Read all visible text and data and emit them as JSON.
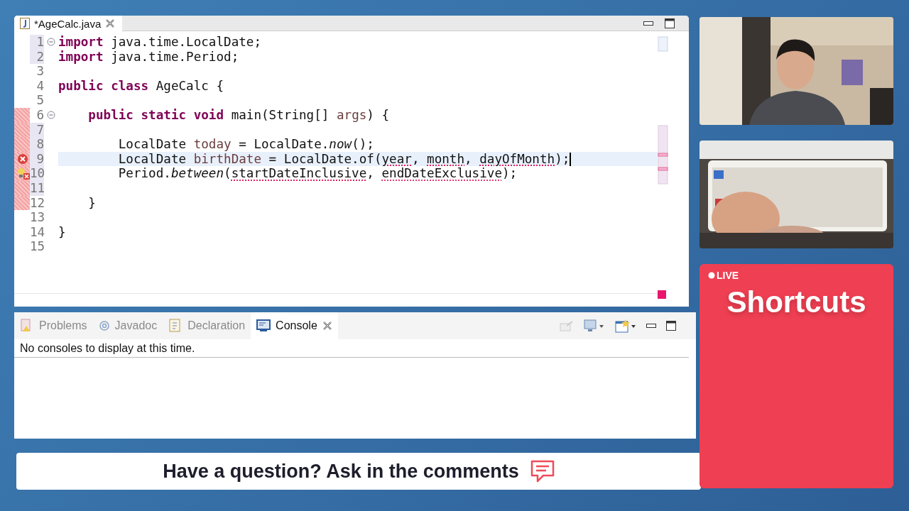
{
  "editor": {
    "tab": {
      "label": "*AgeCalc.java",
      "selected": true
    },
    "lines": [
      {
        "number": "1",
        "fold": true,
        "changed": true,
        "tokens": [
          {
            "kind": "keyword",
            "text": "import"
          },
          {
            "kind": "text",
            "text": " java.time.LocalDate;"
          }
        ]
      },
      {
        "number": "2",
        "changed": true,
        "tokens": [
          {
            "kind": "keyword",
            "text": "import"
          },
          {
            "kind": "text",
            "text": " java.time.Period;"
          }
        ]
      },
      {
        "number": "3"
      },
      {
        "number": "4",
        "tokens": [
          {
            "kind": "keyword",
            "text": "public"
          },
          {
            "kind": "keyword",
            "text": " class"
          },
          {
            "kind": "text",
            "text": " AgeCalc {"
          }
        ]
      },
      {
        "number": "5"
      },
      {
        "number": "6",
        "fold": true,
        "error_range": true,
        "tokens": [
          {
            "kind": "keyword",
            "text": "    public"
          },
          {
            "kind": "keyword",
            "text": " static"
          },
          {
            "kind": "keyword",
            "text": " void"
          },
          {
            "kind": "text",
            "text": " main(String[] "
          },
          {
            "kind": "field",
            "text": "args"
          },
          {
            "kind": "text",
            "text": ") {"
          }
        ]
      },
      {
        "number": "7",
        "changed": true,
        "error_range": true
      },
      {
        "number": "8",
        "changed": true,
        "error_range": true,
        "tokens": [
          {
            "kind": "text",
            "text": "        LocalDate "
          },
          {
            "kind": "field",
            "text": "today"
          },
          {
            "kind": "text",
            "text": " = LocalDate."
          },
          {
            "kind": "static",
            "text": "now"
          },
          {
            "kind": "text",
            "text": "();"
          }
        ]
      },
      {
        "number": "9",
        "changed": true,
        "error_range": true,
        "current": true,
        "caret": true,
        "error_icon": true,
        "tokens": [
          {
            "kind": "text",
            "text": "        LocalDate "
          },
          {
            "kind": "field",
            "text": "birthDate"
          },
          {
            "kind": "text",
            "text": " = LocalDate.of("
          },
          {
            "kind": "error",
            "text": "year"
          },
          {
            "kind": "text",
            "text": ", "
          },
          {
            "kind": "error",
            "text": "month"
          },
          {
            "kind": "text",
            "text": ", "
          },
          {
            "kind": "error",
            "text": "dayOfMonth"
          },
          {
            "kind": "text",
            "text": ");"
          }
        ]
      },
      {
        "number": "10",
        "changed": true,
        "error_range": true,
        "quickfix_error_icon": true,
        "tokens": [
          {
            "kind": "text",
            "text": "        Period."
          },
          {
            "kind": "static",
            "text": "between"
          },
          {
            "kind": "text",
            "text": "("
          },
          {
            "kind": "error",
            "text": "startDateInclusive"
          },
          {
            "kind": "text",
            "text": ", "
          },
          {
            "kind": "error",
            "text": "endDateExclusive"
          },
          {
            "kind": "text",
            "text": ");"
          }
        ]
      },
      {
        "number": "11",
        "changed": true,
        "error_range": true
      },
      {
        "number": "12",
        "error_range": true,
        "tokens": [
          {
            "kind": "text",
            "text": "    }"
          }
        ]
      },
      {
        "number": "13"
      },
      {
        "number": "14",
        "tokens": [
          {
            "kind": "text",
            "text": "}"
          }
        ]
      },
      {
        "number": "15"
      }
    ]
  },
  "bottom_panel": {
    "tabs": [
      {
        "label": "Problems",
        "selected": false
      },
      {
        "label": "Javadoc",
        "selected": false
      },
      {
        "label": "Declaration",
        "selected": false
      },
      {
        "label": "Console",
        "selected": true
      }
    ],
    "message": "No consoles to display at this time."
  },
  "comment_bar": {
    "text": "Have a question? Ask in the comments"
  },
  "live_card": {
    "badge": "LIVE",
    "title": "Shortcuts"
  }
}
